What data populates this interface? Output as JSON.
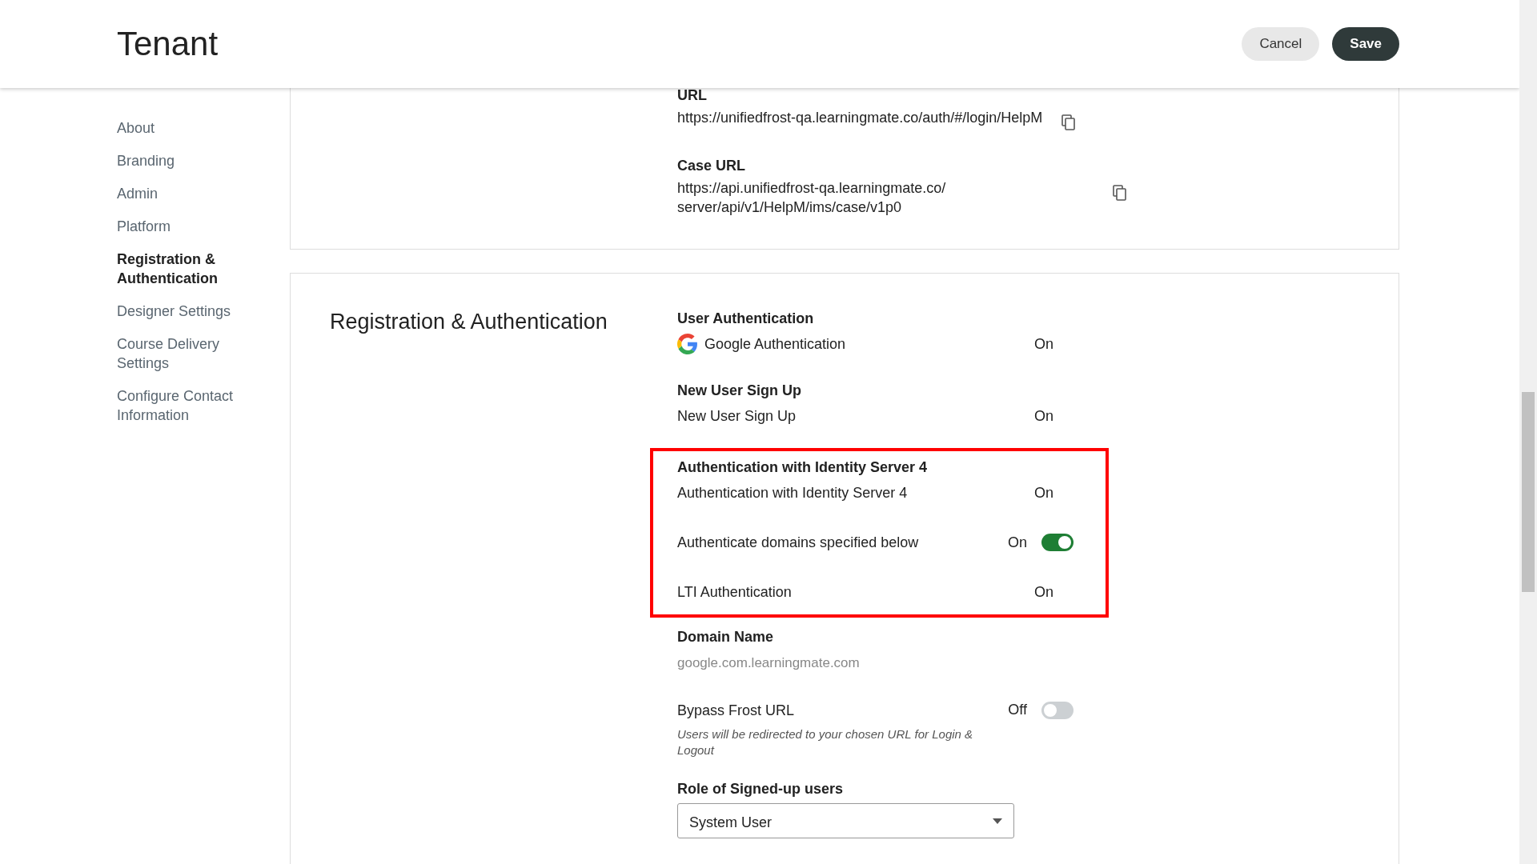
{
  "header": {
    "title": "Tenant",
    "buttons": [
      {
        "label": "Cancel",
        "kind": "secondary"
      },
      {
        "label": "Save",
        "kind": "primary"
      }
    ]
  },
  "sidebar": {
    "items": [
      {
        "label": "About",
        "selected": false
      },
      {
        "label": "Branding",
        "selected": false
      },
      {
        "label": "Admin",
        "selected": false
      },
      {
        "label": "Platform",
        "selected": false
      },
      {
        "label": "Registration & Authentication",
        "selected": true
      },
      {
        "label": "Designer Settings",
        "selected": false
      },
      {
        "label": "Course Delivery Settings",
        "selected": false
      },
      {
        "label": "Configure Contact Information",
        "selected": false
      }
    ]
  },
  "links_card": {
    "fields": [
      {
        "label": "URL",
        "value": "https://unifiedfrost-qa.learningmate.co/auth/#/login/HelpM"
      },
      {
        "label": "Case URL",
        "value": "https://api.unifiedfrost-qa.learningmate.co/ server/api/v1/HelpM/ims/case/v1p0"
      }
    ]
  },
  "section": {
    "title": "Registration & Authentication",
    "groups": [
      {
        "heading": "User Authentication",
        "highlighted": false,
        "rows": [
          {
            "kind": "logo-status",
            "label": "Google Authentication",
            "state": "On"
          }
        ]
      },
      {
        "heading": "New User Sign Up",
        "highlighted": false,
        "rows": [
          {
            "kind": "status",
            "label": "New User Sign Up",
            "state": "On"
          }
        ]
      },
      {
        "heading": "Authentication with Identity Server 4",
        "highlighted": true,
        "rows": [
          {
            "kind": "status",
            "label": "Authentication with Identity Server 4",
            "state": "On"
          },
          {
            "kind": "toggle",
            "label": "Authenticate domains specified below",
            "state": "On",
            "on": true
          },
          {
            "kind": "status",
            "label": "LTI Authentication",
            "state": "On"
          }
        ]
      },
      {
        "heading": "Domain Name",
        "highlighted": false,
        "rows": [
          {
            "kind": "text",
            "value": "google.com.learningmate.com"
          }
        ]
      },
      {
        "highlighted": false,
        "rows": [
          {
            "kind": "toggle",
            "label": "Bypass Frost URL",
            "state": "Off",
            "on": false,
            "note": "Users will be redirected to your chosen URL for Login & Logout"
          }
        ]
      },
      {
        "heading": "Role of Signed-up users",
        "highlighted": false,
        "rows": [
          {
            "kind": "select",
            "value": "System User"
          }
        ]
      }
    ]
  }
}
